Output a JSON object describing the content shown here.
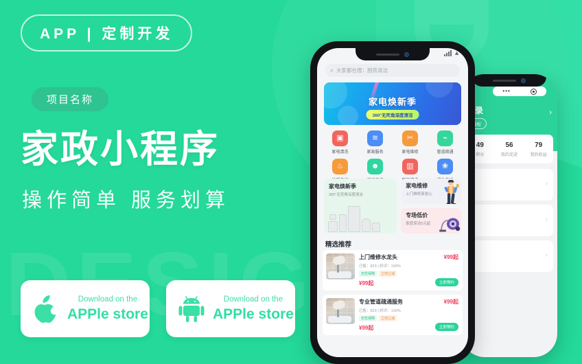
{
  "poster": {
    "badge_top": "APP | 定制开发",
    "project_label": "项目名称",
    "headline": "家政小程序",
    "subline": "操作简单  服务划算",
    "watermark": "DESIGN"
  },
  "colors": {
    "background_green": "#24D99A",
    "pill_green": "#2EC391",
    "accent_mint": "#32DFA3",
    "price_red": "#EF4060",
    "banner_blue": "#1C9BF0"
  },
  "stores": [
    {
      "icon": "apple-icon",
      "top_label": "Download on the",
      "main_label": "APPle store"
    },
    {
      "icon": "android-icon",
      "top_label": "Download on the",
      "main_label": "APPle store"
    }
  ],
  "phone_front": {
    "search": {
      "icon": "search-icon",
      "value": "",
      "placeholder": "大家都在搜：厨房清洁"
    },
    "status": {
      "signal_icon": "signal-icon",
      "wifi_icon": "wifi-icon"
    },
    "banner": {
      "title": "家电焕新季",
      "tag": "360°无死角深度清洁"
    },
    "icon_grid": [
      {
        "name": "washer-icon",
        "glyph": "▣",
        "color": "#F2655E",
        "label": "家电清洗"
      },
      {
        "name": "housekeeping-icon",
        "glyph": "≋",
        "color": "#4C8DF6",
        "label": "家政服务"
      },
      {
        "name": "tools-icon",
        "glyph": "✂",
        "color": "#F79A3C",
        "label": "家电维修"
      },
      {
        "name": "pipe-icon",
        "glyph": "⌁",
        "color": "#35D79B",
        "label": "管道疏通"
      },
      {
        "name": "floor-heating-icon",
        "glyph": "♨",
        "color": "#F79A3C",
        "label": "地暖养护"
      },
      {
        "name": "nanny-icon",
        "glyph": "☻",
        "color": "#2FD6A0",
        "label": "保姆月嫂"
      },
      {
        "name": "curtain-icon",
        "glyph": "▥",
        "color": "#F2655E",
        "label": "窗帘清洗"
      },
      {
        "name": "plant-icon",
        "glyph": "❀",
        "color": "#4C8DF6",
        "label": "绿化养护"
      }
    ],
    "cards": {
      "left": {
        "title": "家电焕新季",
        "sub": "360°无死角深度清洁"
      },
      "repair": {
        "title": "家电维修",
        "sub": "上门维修真省心"
      },
      "sale": {
        "title": "专场低价",
        "sub": "家庭保洁5元起"
      }
    },
    "rec_title": "精选推荐",
    "rec_items": [
      {
        "name": "上门维修水龙头",
        "meta": "已售：823 | 好评：100%",
        "tags": [
          "无忧保障",
          "立刻立减"
        ],
        "price_top": "¥99起",
        "price": "¥99起",
        "button": "立即预约"
      },
      {
        "name": "专业管道疏通服务",
        "meta": "已售：823 | 好评：100%",
        "tags": [
          "无忧保障",
          "立刻立减"
        ],
        "price_top": "¥99起",
        "price": "¥99起",
        "button": "立即预约"
      }
    ]
  },
  "phone_back": {
    "menu_dots": "•••",
    "close_icon": "target-icon",
    "login_label": "登录",
    "badge_label": "授权",
    "chevron": "›",
    "stats": [
      {
        "num": "49",
        "label": "积分"
      },
      {
        "num": "56",
        "label": "我的足迹"
      },
      {
        "num": "79",
        "label": "我的权益"
      }
    ]
  }
}
